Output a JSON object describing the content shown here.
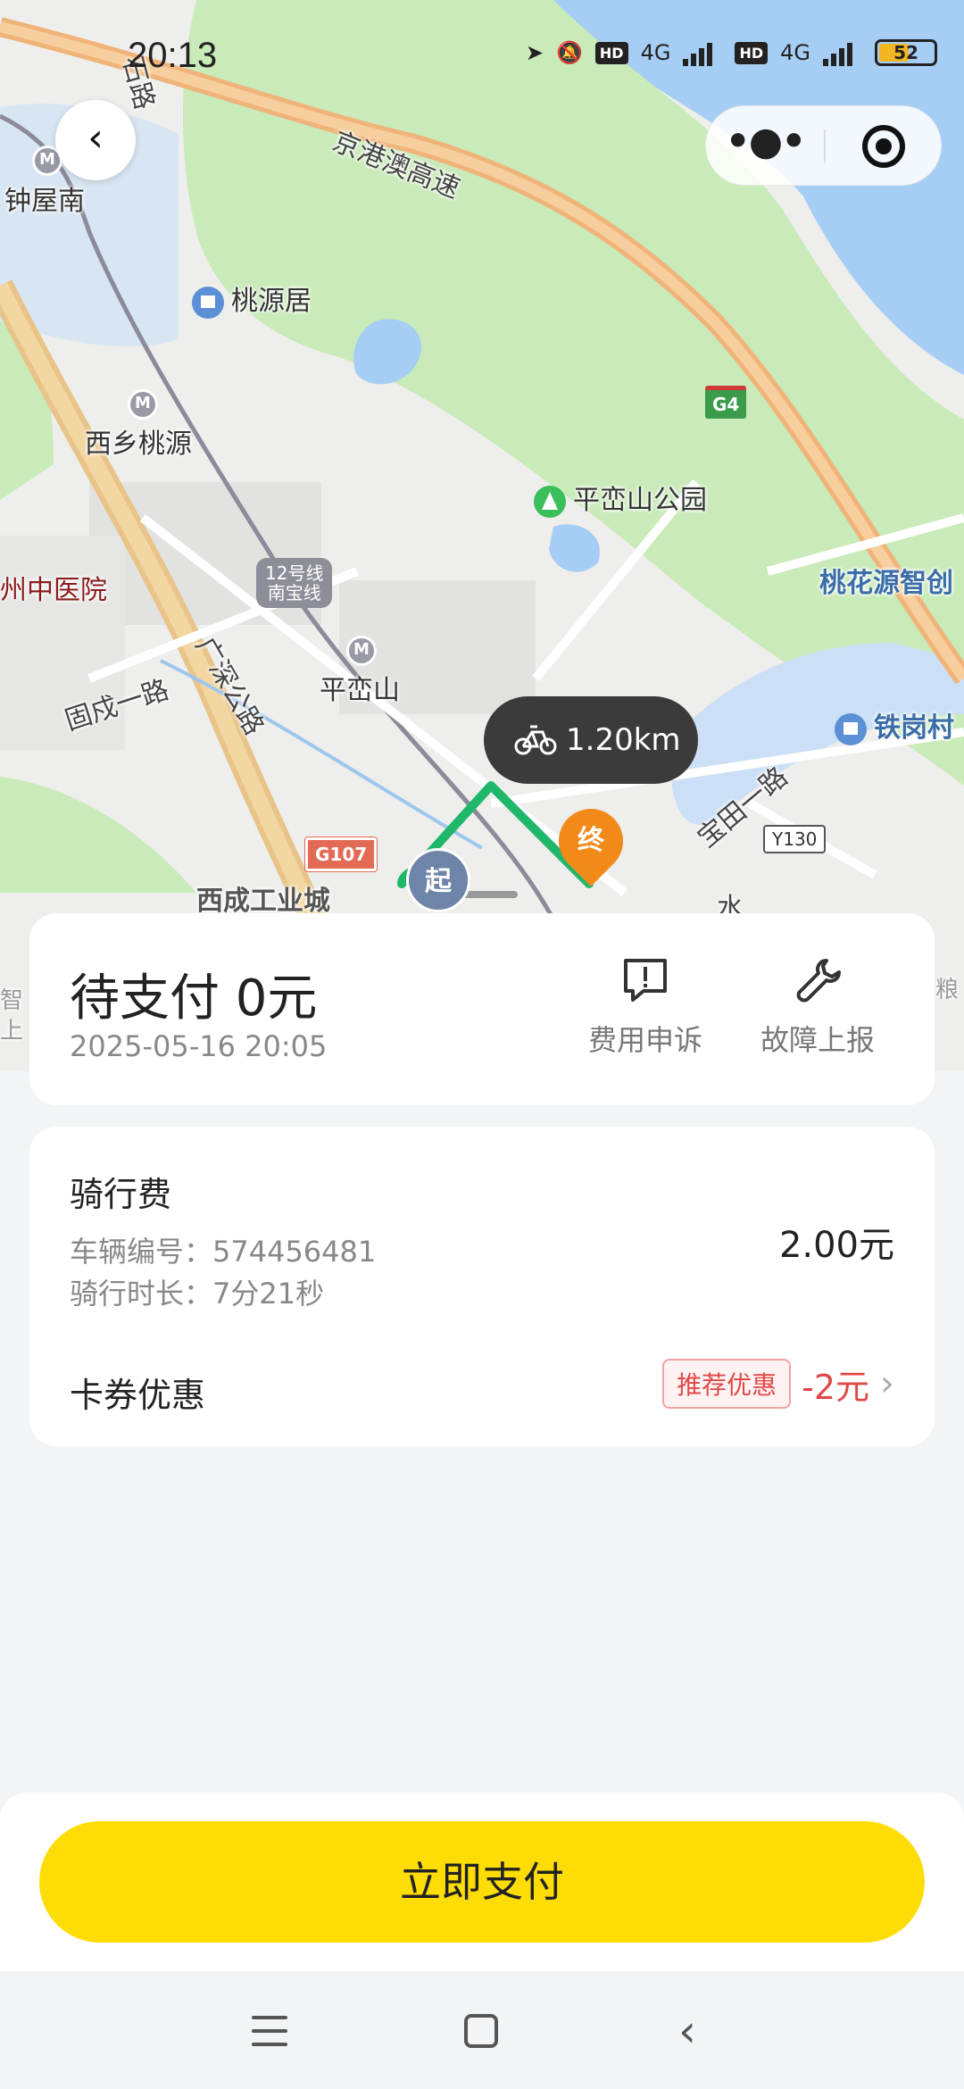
{
  "status_bar": {
    "time": "20:13",
    "net1": "4G",
    "net2": "4G",
    "hd": "HD",
    "battery": "52"
  },
  "map": {
    "labels": {
      "zhongwunan": "钟屋南",
      "taoyuanju": "桃源居",
      "xixiangtaoyuan": "西乡桃源",
      "pingluanshan_park": "平峦山公园",
      "zhongyiyuan": "州中医院",
      "taohuayuan": "桃花源智创",
      "pingluanshan": "平峦山",
      "guchengyilu": "固戍一路",
      "tiegangcun": "铁岗村",
      "baotianyilu": "宝田一路",
      "xicheng": "西成工业城",
      "jinggangao": "京港澳高速",
      "guangshen": "广深公路",
      "shilu": "石路",
      "edge1": "智",
      "edge2": "上",
      "edge3": "粮",
      "water": "水"
    },
    "badges": {
      "g4": "G4",
      "g107": "G107",
      "y130": "Y130",
      "line12_1": "12号线",
      "line12_2": "南宝线"
    },
    "distance": "1.20km",
    "start_marker": "起",
    "end_marker": "终"
  },
  "summary": {
    "title": "待支付 0元",
    "date": "2025-05-16 20:05",
    "appeal_label": "费用申诉",
    "report_label": "故障上报"
  },
  "fee": {
    "title": "骑行费",
    "vehicle_line": "车辆编号：574456481",
    "duration_line": "骑行时长：7分21秒",
    "amount": "2.00元",
    "coupon_title": "卡券优惠",
    "coupon_tag": "推荐优惠",
    "coupon_value": "-2元"
  },
  "pay_button": "立即支付",
  "colors": {
    "accent": "#fddd05",
    "route": "#1fb76a",
    "discount": "#e04848"
  },
  "icons": [
    "back-arrow-icon",
    "more-icon",
    "target-icon",
    "bike-icon",
    "alert-message-icon",
    "wrench-icon",
    "chevron-right-icon",
    "menu-icon",
    "home-icon",
    "back-icon"
  ]
}
